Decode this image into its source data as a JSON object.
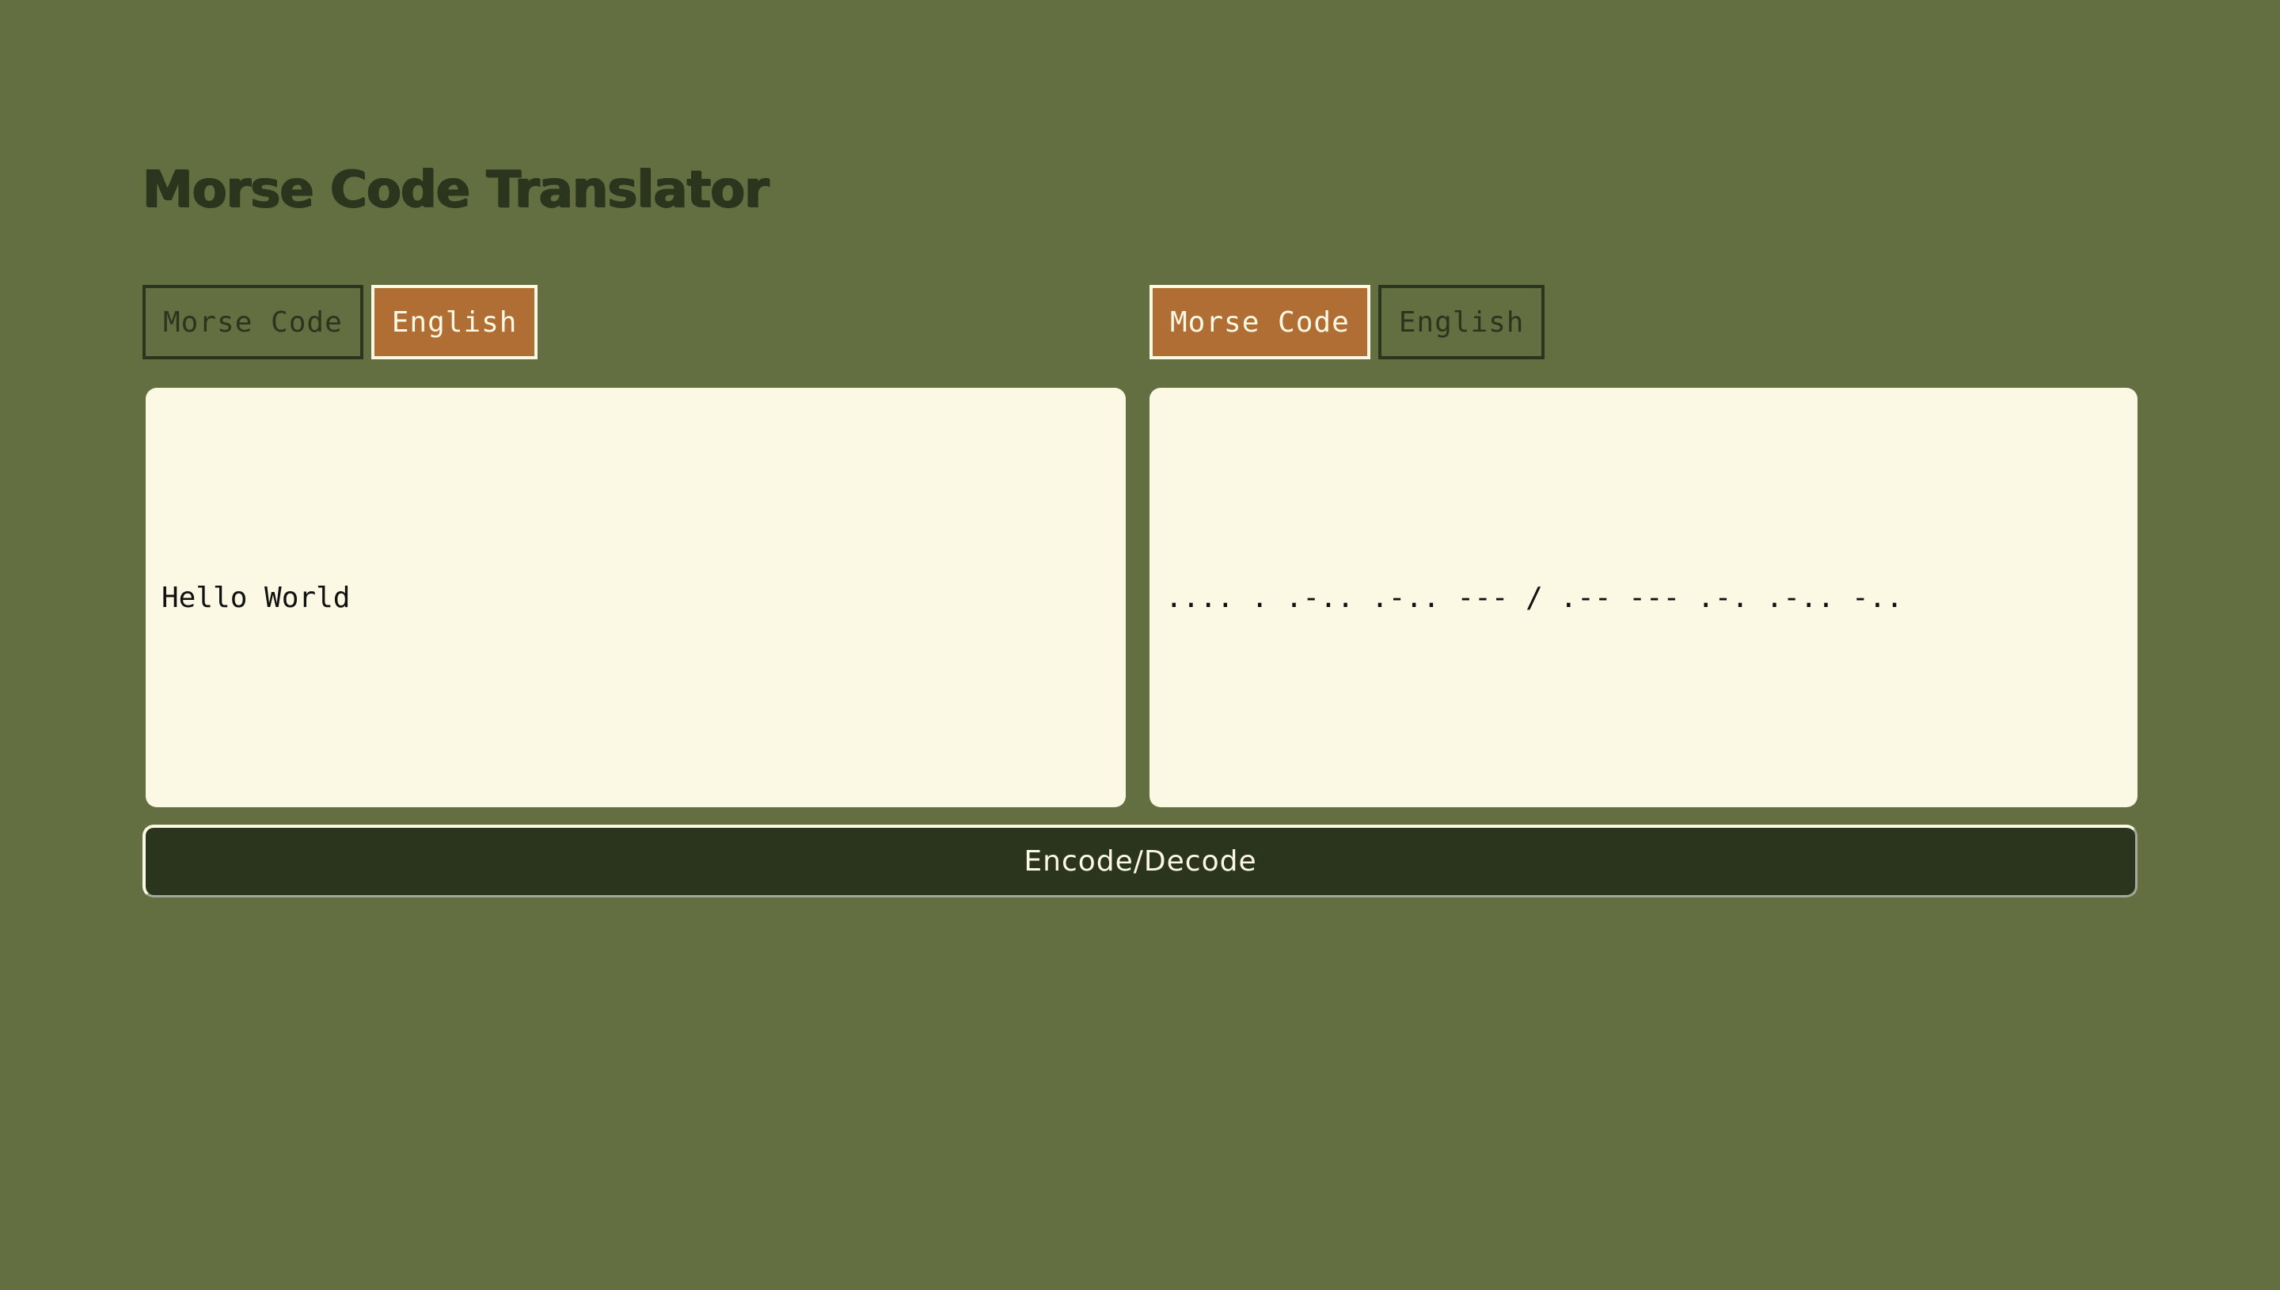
{
  "app": {
    "title": "Morse Code Translator"
  },
  "source": {
    "tabs": [
      {
        "label": "Morse Code",
        "active": false
      },
      {
        "label": "English",
        "active": true
      }
    ],
    "text": "Hello World"
  },
  "target": {
    "tabs": [
      {
        "label": "Morse Code",
        "active": true
      },
      {
        "label": "English",
        "active": false
      }
    ],
    "text": ".... . .-.. .-.. --- / .-- --- .-. .-.. -.."
  },
  "action": {
    "label": "Encode/Decode"
  },
  "colors": {
    "background": "#636e41",
    "dark": "#2b351d",
    "active_tab": "#b06e35",
    "panel": "#fbf9e3"
  }
}
